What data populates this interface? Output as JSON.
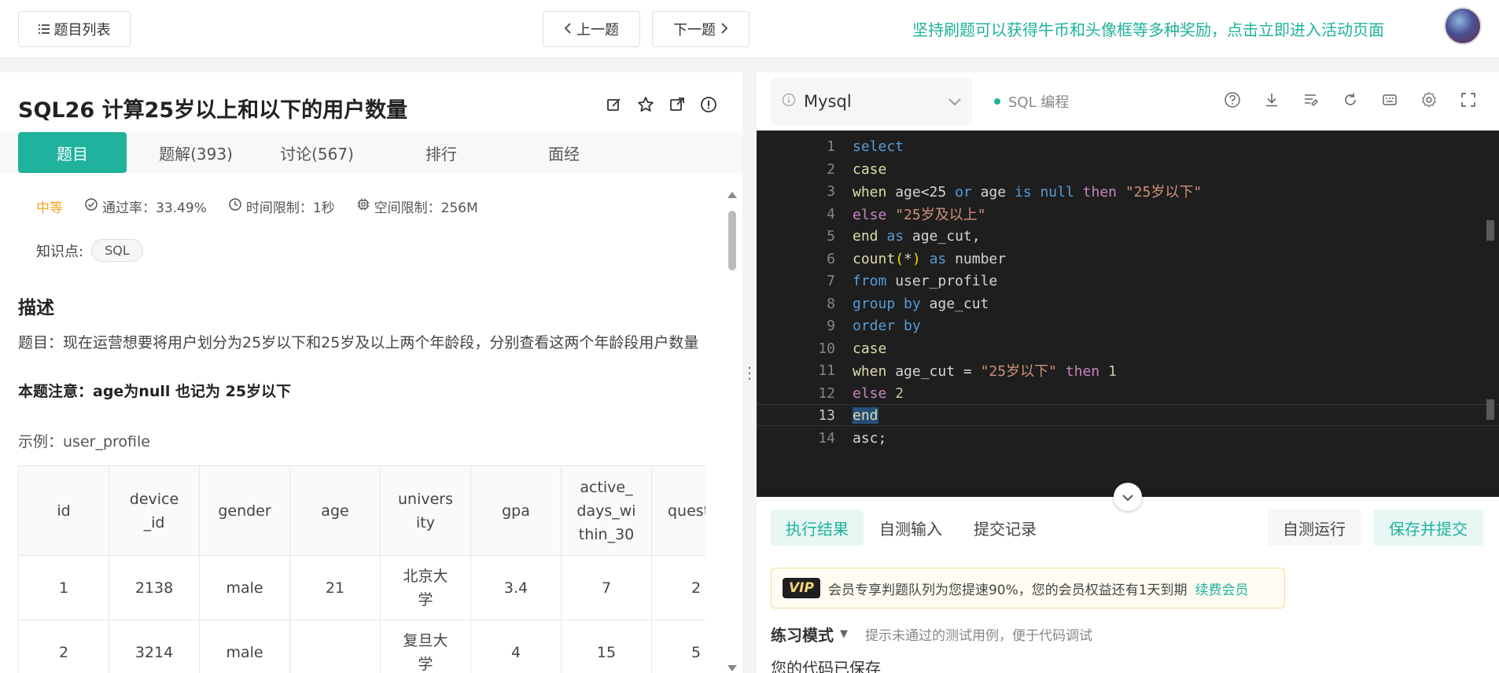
{
  "topbar": {
    "list_label": "题目列表",
    "prev_label": "上一题",
    "next_label": "下一题",
    "promo_text": "坚持刷题可以获得牛币和头像框等多种奖励，点击立即进入活动页面"
  },
  "question": {
    "title": "SQL26  计算25岁以上和以下的用户数量",
    "tabs": [
      "题目",
      "题解(393)",
      "讨论(567)",
      "排行",
      "面经"
    ],
    "difficulty": "中等",
    "pass_rate": "通过率：33.49%",
    "time_limit": "时间限制：1秒",
    "space_limit": "空间限制：256M",
    "knowledge_label": "知识点:",
    "knowledge_tag": "SQL",
    "section_title": "描述",
    "description": "题目：现在运营想要将用户划分为25岁以下和25岁及以上两个年龄段，分别查看这两个年龄段用户数量",
    "note": "本题注意：age为null 也记为 25岁以下",
    "example_label": "示例：user_profile"
  },
  "table": {
    "headers": [
      "id",
      "device_id",
      "gender",
      "age",
      "university",
      "gpa",
      "active_days_within_30",
      "question_cnt"
    ],
    "rows": [
      [
        "1",
        "2138",
        "male",
        "21",
        "北京大学",
        "3.4",
        "7",
        "2"
      ],
      [
        "2",
        "3214",
        "male",
        "",
        "复旦大学",
        "4",
        "15",
        "5"
      ]
    ]
  },
  "editor": {
    "language": "Mysql",
    "mode": "SQL 编程",
    "current_line": 13,
    "line_numbers": [
      "1",
      "2",
      "3",
      "4",
      "5",
      "6",
      "7",
      "8",
      "9",
      "10",
      "11",
      "12",
      "13",
      "14"
    ]
  },
  "results": {
    "tabs": [
      "执行结果",
      "自测输入",
      "提交记录"
    ],
    "self_run": "自测运行",
    "save_submit": "保存并提交",
    "vip_badge": "VIP",
    "vip_text": "会员专享判题队列为您提速90%，您的会员权益还有1天到期",
    "vip_link": "续费会员",
    "practice_mode": "练习模式",
    "practice_hint": "提示未通过的测试用例，便于代码调试",
    "saved_text": "您的代码已保存"
  },
  "colors": {
    "accent": "#1fb29c",
    "difficulty": "#f5a623",
    "editor_bg": "#1e1e1e"
  }
}
